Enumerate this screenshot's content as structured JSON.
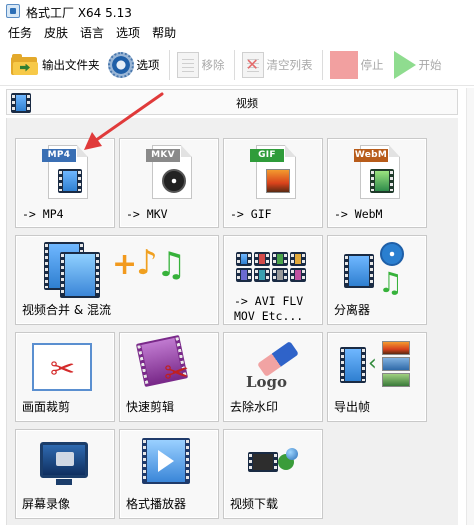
{
  "window": {
    "title": "格式工厂 X64 5.13"
  },
  "menu": [
    "任务",
    "皮肤",
    "语言",
    "选项",
    "帮助"
  ],
  "toolbar": {
    "output_folder": "输出文件夹",
    "options": "选项",
    "remove": "移除",
    "clear_list": "清空列表",
    "stop": "停止",
    "start": "开始"
  },
  "section": {
    "label": "视频"
  },
  "tiles": {
    "mp4": "-> MP4",
    "mkv": "-> MKV",
    "gif": "-> GIF",
    "webm": "-> WebM",
    "merge": "视频合并 & 混流",
    "avi": "-> AVI FLV\nMOV Etc...",
    "splitter": "分离器",
    "crop": "画面裁剪",
    "quick_clip": "快速剪辑",
    "remove_watermark": "去除水印",
    "export_frames": "导出帧",
    "screen_record": "屏幕录像",
    "player": "格式播放器",
    "video_download": "视频下载"
  },
  "badges": {
    "mp4": "MP4",
    "mkv": "MKV",
    "gif": "GIF",
    "webm": "WebM"
  },
  "icon_logo_text": "Logo",
  "colors": {
    "mp4": "#3a6fb4",
    "mkv": "#8a8a8a",
    "gif": "#2f9c3a",
    "webm": "#b85c1a",
    "arrow": "#e03a3a"
  }
}
